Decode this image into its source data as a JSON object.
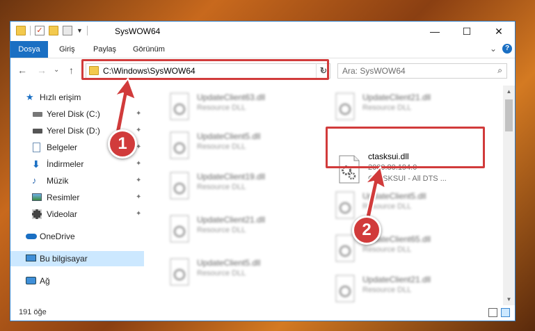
{
  "window": {
    "title": "SysWOW64",
    "controls": {
      "minimize": "—",
      "maximize": "☐",
      "close": "✕"
    }
  },
  "ribbon": {
    "tabs": [
      "Dosya",
      "Giriş",
      "Paylaş",
      "Görünüm"
    ],
    "expand_glyph": "⌄",
    "help_glyph": "?"
  },
  "nav": {
    "back": "←",
    "forward": "→",
    "recent": "⌄",
    "up": "↑",
    "address": "C:\\Windows\\SysWOW64",
    "address_dropdown": "⌄",
    "refresh": "↻",
    "search_placeholder": "Ara: SysWOW64",
    "search_glyph": "⌕"
  },
  "sidebar": {
    "items": [
      {
        "label": "Hızlı erişim",
        "icon": "star-icon",
        "pinned": false
      },
      {
        "label": "Yerel Disk (C:)",
        "icon": "drive-icon",
        "pinned": true
      },
      {
        "label": "Yerel Disk (D:)",
        "icon": "drive-icon",
        "pinned": true
      },
      {
        "label": "Belgeler",
        "icon": "documents-icon",
        "pinned": true
      },
      {
        "label": "İndirmeler",
        "icon": "download-icon",
        "pinned": true
      },
      {
        "label": "Müzik",
        "icon": "music-icon",
        "pinned": true
      },
      {
        "label": "Resimler",
        "icon": "pictures-icon",
        "pinned": true
      },
      {
        "label": "Videolar",
        "icon": "videos-icon",
        "pinned": true
      },
      {
        "label": "OneDrive",
        "icon": "cloud-icon",
        "pinned": false
      },
      {
        "label": "Bu bilgisayar",
        "icon": "computer-icon",
        "pinned": false,
        "selected": true
      },
      {
        "label": "Ağ",
        "icon": "network-icon",
        "pinned": false
      }
    ],
    "pin_glyph": "📌"
  },
  "files": {
    "left": [
      {
        "name": "UpdateClient63.dll",
        "sub": "Resource DLL"
      },
      {
        "name": "UpdateClient5.dll",
        "sub": "Resource DLL"
      },
      {
        "name": "UpdateClient19.dll",
        "sub": "Resource DLL"
      },
      {
        "name": "UpdateClient21.dll",
        "sub": "Resource DLL"
      },
      {
        "name": "UpdateClient5.dll",
        "sub": "Resource DLL"
      }
    ],
    "right": [
      {
        "name": "UpdateClient21.dll",
        "sub": "Resource DLL"
      },
      {
        "name": "ctasksui.dll",
        "sub": "2000.80.194.0",
        "sub2": "CTASKSUI - All DTS ...",
        "highlight": true
      },
      {
        "name": "UpdateClient5.dll",
        "sub": "Resource DLL"
      },
      {
        "name": "UpdateClient65.dll",
        "sub": "Resource DLL"
      },
      {
        "name": "UpdateClient21.dll",
        "sub": "Resource DLL"
      }
    ]
  },
  "status": {
    "count": "191 öğe"
  },
  "callouts": {
    "one": "1",
    "two": "2"
  },
  "colors": {
    "accent": "#1a6fc3",
    "highlight_red": "#d13b3b",
    "selected_bg": "#cce8ff"
  }
}
